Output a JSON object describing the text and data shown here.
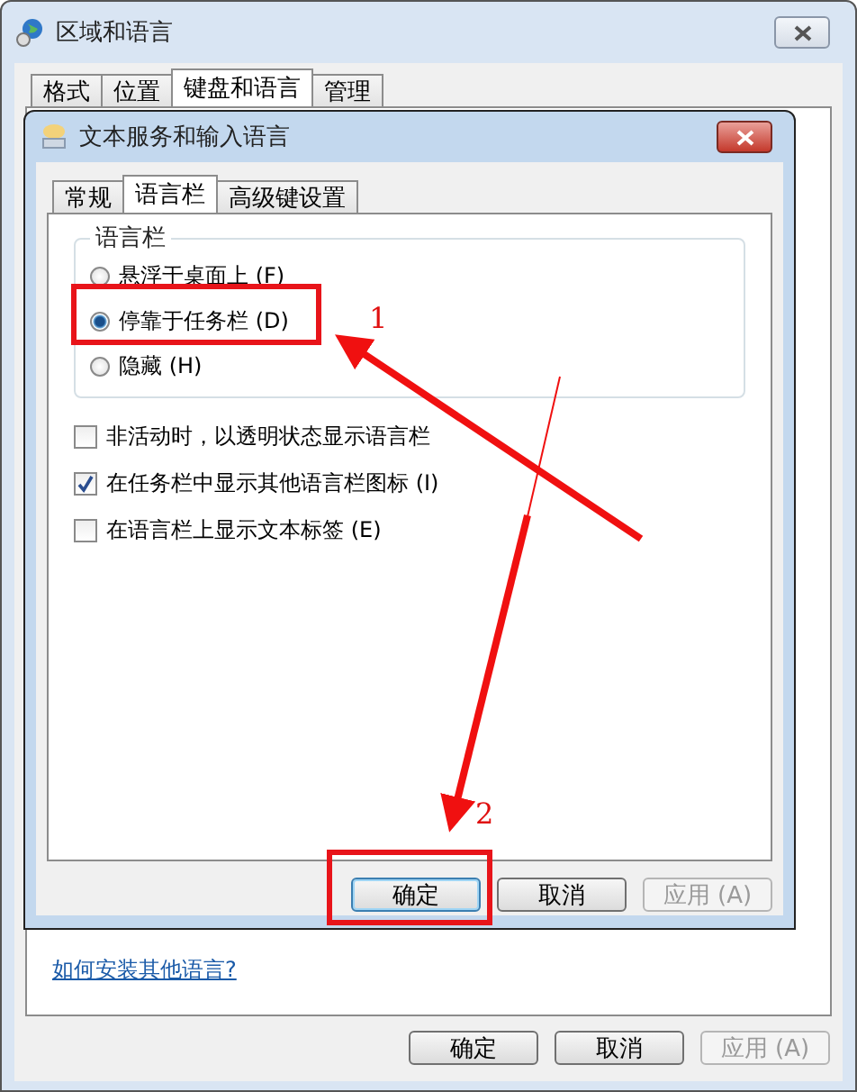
{
  "window": {
    "title": "区域和语言",
    "tabs": [
      {
        "label": "格式",
        "selected": false
      },
      {
        "label": "位置",
        "selected": false
      },
      {
        "label": "键盘和语言",
        "selected": true
      },
      {
        "label": "管理",
        "selected": false
      }
    ]
  },
  "dialog": {
    "title": "文本服务和输入语言",
    "tabs": [
      {
        "label": "常规",
        "selected": false
      },
      {
        "label": "语言栏",
        "selected": true
      },
      {
        "label": "高级键设置",
        "selected": false
      }
    ],
    "group": {
      "title": "语言栏",
      "options": [
        {
          "label": "悬浮于桌面上 (F)",
          "selected": false
        },
        {
          "label": "停靠于任务栏 (D)",
          "selected": true
        },
        {
          "label": "隐藏 (H)",
          "selected": false
        }
      ]
    },
    "checkboxes": [
      {
        "label": "非活动时，以透明状态显示语言栏",
        "checked": false
      },
      {
        "label": "在任务栏中显示其他语言栏图标 (I)",
        "checked": true
      },
      {
        "label": "在语言栏上显示文本标签 (E)",
        "checked": false
      }
    ],
    "buttons": [
      {
        "label": "确定",
        "disabled": false,
        "default": true
      },
      {
        "label": "取消",
        "disabled": false,
        "default": false
      },
      {
        "label": "应用 (A)",
        "disabled": true,
        "default": false
      }
    ]
  },
  "link": "如何安装其他语言?",
  "buttons": [
    {
      "label": "确定",
      "disabled": false
    },
    {
      "label": "取消",
      "disabled": false
    },
    {
      "label": "应用 (A)",
      "disabled": true
    }
  ],
  "annotations": [
    {
      "label": "1"
    },
    {
      "label": "2"
    }
  ]
}
